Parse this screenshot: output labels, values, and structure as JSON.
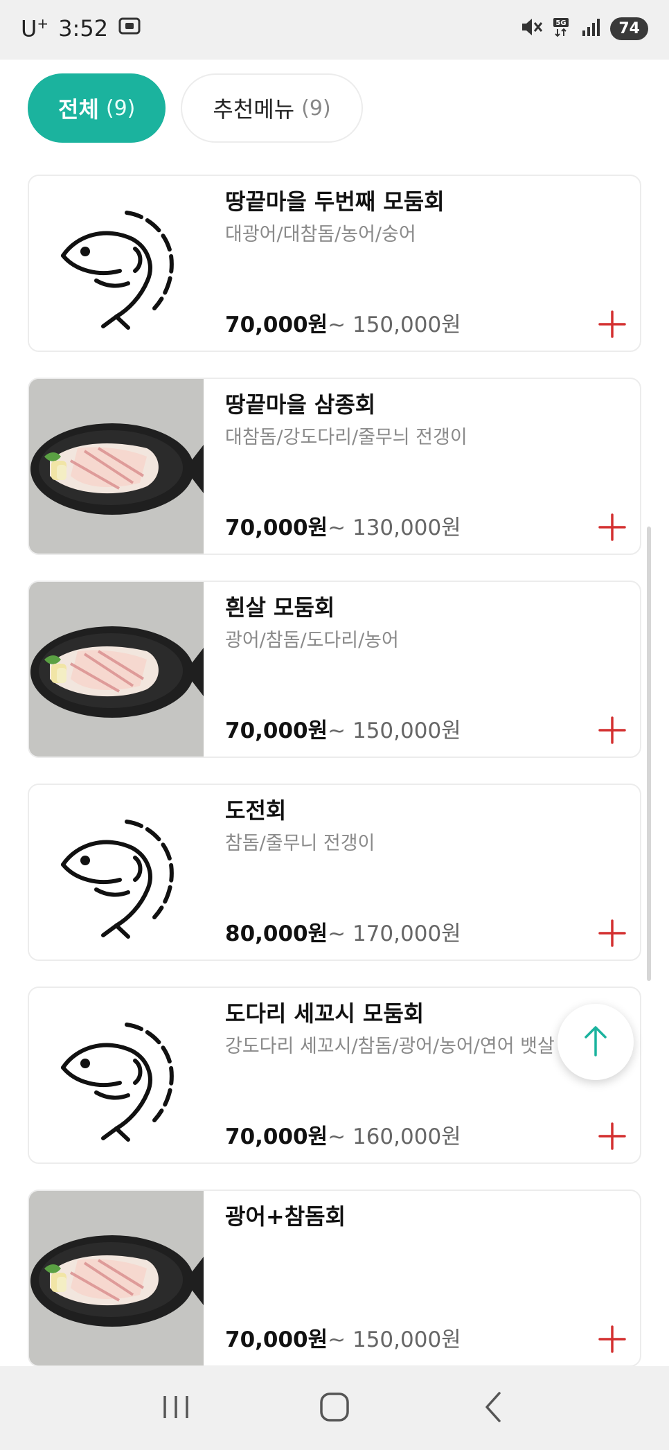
{
  "status_bar": {
    "carrier": "U",
    "carrier_sup": "+",
    "time": "3:52",
    "battery": "74"
  },
  "tabs": [
    {
      "label": "전체",
      "count": "(9)",
      "active": true
    },
    {
      "label": "추천메뉴",
      "count": "(9)",
      "active": false
    }
  ],
  "menu": {
    "items": [
      {
        "name": "땅끝마을 두번째 모둠회",
        "desc": "대광어/대참돔/농어/숭어",
        "price_min": "70,000원",
        "price_max": "~ 150,000원",
        "image": "fish-line-icon"
      },
      {
        "name": "땅끝마을 삼종회",
        "desc": "대참돔/강도다리/줄무늬 전갱이",
        "price_min": "70,000원",
        "price_max": "~ 130,000원",
        "image": "sashimi-photo"
      },
      {
        "name": "흰살 모둠회",
        "desc": "광어/참돔/도다리/농어",
        "price_min": "70,000원",
        "price_max": "~ 150,000원",
        "image": "sashimi-photo"
      },
      {
        "name": "도전회",
        "desc": "참돔/줄무니 전갱이",
        "price_min": "80,000원",
        "price_max": "~ 170,000원",
        "image": "fish-line-icon"
      },
      {
        "name": "도다리 세꼬시 모둠회",
        "desc": "강도다리 세꼬시/참돔/광어/농어/연어 뱃살",
        "price_min": "70,000원",
        "price_max": "~ 160,000원",
        "image": "fish-line-icon"
      },
      {
        "name": "광어+참돔회",
        "desc": "",
        "price_min": "70,000원",
        "price_max": "~ 150,000원",
        "image": "sashimi-photo"
      }
    ]
  },
  "colors": {
    "accent": "#1bb39e",
    "add_button": "#d32f2f",
    "price_max": "#666666",
    "description": "#8a8a8a"
  },
  "icons": {
    "back_to_top": "arrow-up-icon",
    "nav_recents": "recents-icon",
    "nav_home": "home-icon",
    "nav_back": "back-icon"
  }
}
